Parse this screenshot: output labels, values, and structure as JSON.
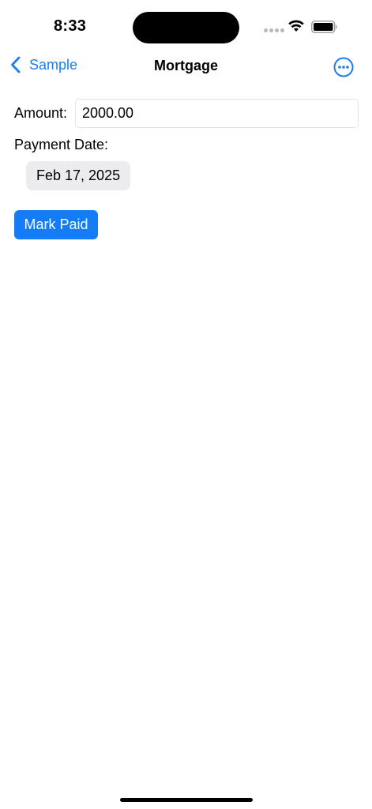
{
  "status_bar": {
    "time": "8:33"
  },
  "nav": {
    "back_label": "Sample",
    "title": "Mortgage",
    "more_icon": "ellipsis-circle-icon",
    "accent": "#1a7ef0"
  },
  "form": {
    "amount_label": "Amount:",
    "amount_value": "2000.00",
    "payment_date_label": "Payment Date:",
    "payment_date_value": "Feb 17, 2025",
    "mark_paid_label": "Mark Paid",
    "button_color": "#147cf6"
  }
}
